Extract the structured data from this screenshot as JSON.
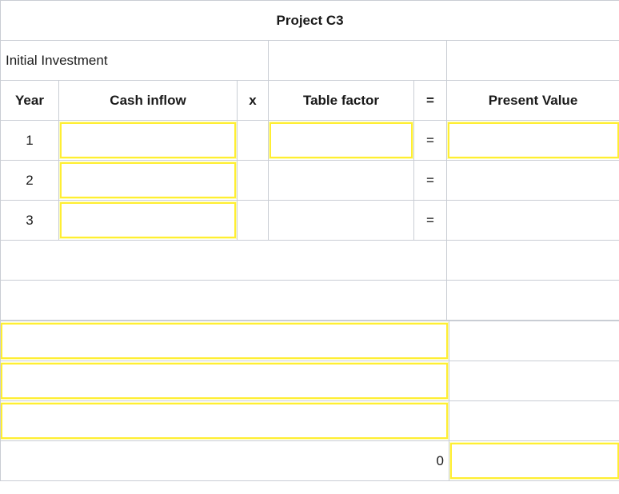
{
  "title": "Project C3",
  "initial_investment": {
    "label": "Initial Investment",
    "value_1": "",
    "value_2": ""
  },
  "columns": {
    "year": "Year",
    "cash_inflow": "Cash inflow",
    "times": "x",
    "table_factor": "Table factor",
    "equals": "=",
    "present_value": "Present Value"
  },
  "rows": [
    {
      "year": "1",
      "cash_inflow": "",
      "times": "",
      "table_factor": "",
      "equals": "=",
      "present_value": ""
    },
    {
      "year": "2",
      "cash_inflow": "",
      "times": "",
      "table_factor": "",
      "equals": "=",
      "present_value": ""
    },
    {
      "year": "3",
      "cash_inflow": "",
      "times": "",
      "table_factor": "",
      "equals": "=",
      "present_value": ""
    }
  ],
  "subtotal_row": {
    "label": "",
    "present_value": ""
  },
  "lower_section": {
    "rows": [
      {
        "label": "",
        "value": ""
      },
      {
        "label": "",
        "value": ""
      },
      {
        "label": "",
        "value": ""
      },
      {
        "label": "0",
        "value": ""
      }
    ]
  },
  "colors": {
    "title_band": "#8ba7d4",
    "header_band": "#b2c1d8",
    "input_border": "#ffee33",
    "input_fill": "#ffffb4",
    "grid_line": "#c9cdd4"
  }
}
